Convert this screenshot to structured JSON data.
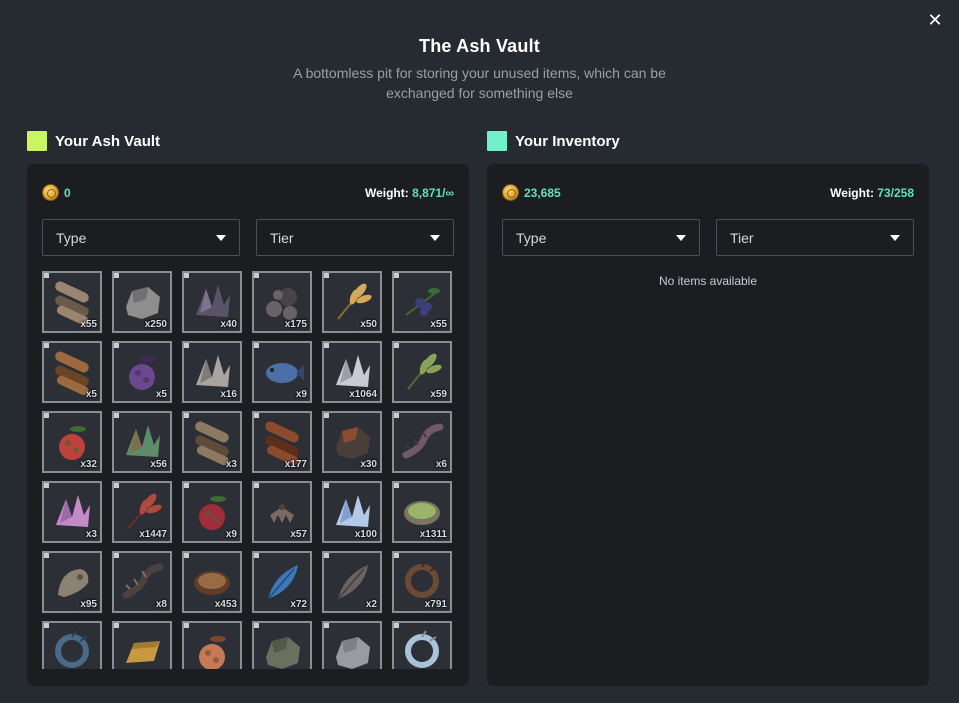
{
  "header": {
    "title": "The Ash Vault",
    "subtitle": "A bottomless pit for storing your unused items, which can be exchanged for something else"
  },
  "colors": {
    "vault_swatch": "#c9f560",
    "inventory_swatch": "#72f0c8",
    "accent": "#62e1b4"
  },
  "vault": {
    "label": "Your Ash Vault",
    "coins": "0",
    "weight_label": "Weight:",
    "weight_value": "8,871/∞",
    "type_filter": "Type",
    "tier_filter": "Tier",
    "items": [
      {
        "icon": "log-bundle-icon",
        "qty": "x55"
      },
      {
        "icon": "stone-icon",
        "qty": "x250"
      },
      {
        "icon": "dark-ore-icon",
        "qty": "x40"
      },
      {
        "icon": "rubble-icon",
        "qty": "x175"
      },
      {
        "icon": "wheat-icon",
        "qty": "x50"
      },
      {
        "icon": "berry-branch-icon",
        "qty": "x55"
      },
      {
        "icon": "wood-logs-icon",
        "qty": "x5"
      },
      {
        "icon": "blackberry-icon",
        "qty": "x5"
      },
      {
        "icon": "crystal-ore-icon",
        "qty": "x16"
      },
      {
        "icon": "fish-icon",
        "qty": "x9"
      },
      {
        "icon": "quartz-crystal-icon",
        "qty": "x1064"
      },
      {
        "icon": "green-wheat-icon",
        "qty": "x59"
      },
      {
        "icon": "strawberry-icon",
        "qty": "x32"
      },
      {
        "icon": "green-crystal-icon",
        "qty": "x56"
      },
      {
        "icon": "log-pile-icon",
        "qty": "x3"
      },
      {
        "icon": "bark-log-icon",
        "qty": "x177"
      },
      {
        "icon": "magma-stone-icon",
        "qty": "x30"
      },
      {
        "icon": "spiked-tail-icon",
        "qty": "x6"
      },
      {
        "icon": "pink-crystal-icon",
        "qty": "x3"
      },
      {
        "icon": "red-wheat-icon",
        "qty": "x1447"
      },
      {
        "icon": "grapes-icon",
        "qty": "x9"
      },
      {
        "icon": "bat-wing-icon",
        "qty": "x57"
      },
      {
        "icon": "ice-crystal-icon",
        "qty": "x100"
      },
      {
        "icon": "bowl-icon",
        "qty": "x1311"
      },
      {
        "icon": "skull-icon",
        "qty": "x95"
      },
      {
        "icon": "claw-icon",
        "qty": "x8"
      },
      {
        "icon": "mushroom-cap-icon",
        "qty": "x453"
      },
      {
        "icon": "blue-feather-icon",
        "qty": "x72"
      },
      {
        "icon": "shell-icon",
        "qty": "x2"
      },
      {
        "icon": "antler-icon",
        "qty": "x791"
      },
      {
        "icon": "serpent-icon",
        "qty": ""
      },
      {
        "icon": "gold-bar-icon",
        "qty": ""
      },
      {
        "icon": "mushrooms-icon",
        "qty": ""
      },
      {
        "icon": "creature-icon",
        "qty": ""
      },
      {
        "icon": "fur-icon",
        "qty": ""
      },
      {
        "icon": "horn-icon",
        "qty": ""
      }
    ]
  },
  "inventory": {
    "label": "Your Inventory",
    "coins": "23,685",
    "weight_label": "Weight:",
    "weight_value": "73/258",
    "type_filter": "Type",
    "tier_filter": "Tier",
    "empty_message": "No items available"
  }
}
